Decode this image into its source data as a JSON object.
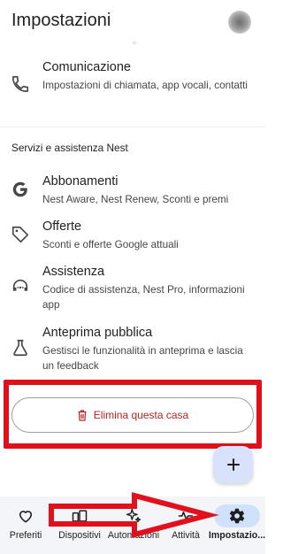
{
  "header": {
    "title": "Impostazioni"
  },
  "rows": [
    {
      "title": "Comunicazione",
      "subtitle": "Impostazioni di chiamata, app vocali, contatti",
      "icon": "phone-icon"
    },
    {
      "title": "Abbonamenti",
      "subtitle": "Nest Aware, Nest Renew, Sconti e premi",
      "icon": "google-g-icon"
    },
    {
      "title": "Offerte",
      "subtitle": "Sconti e offerte Google attuali",
      "icon": "tag-icon"
    },
    {
      "title": "Assistenza",
      "subtitle": "Codice di assistenza, Nest Pro, informazioni app",
      "icon": "support-icon"
    },
    {
      "title": "Anteprima pubblica",
      "subtitle": "Gestisci le funzionalità in anteprima e lascia un feedback",
      "icon": "flask-icon"
    }
  ],
  "section": {
    "header": "Servizi e assistenza Nest"
  },
  "delete_button": {
    "label": "Elimina questa casa",
    "color": "#b3261e"
  },
  "fab": {
    "icon": "plus-icon"
  },
  "annotation": {
    "color": "#e0101c"
  },
  "bottom_nav": [
    {
      "label": "Preferiti",
      "icon": "heart-icon"
    },
    {
      "label": "Dispositivi",
      "icon": "devices-icon"
    },
    {
      "label": "Automazioni",
      "icon": "sparkle-icon"
    },
    {
      "label": "Attività",
      "icon": "activity-icon"
    },
    {
      "label": "Impostazio...",
      "icon": "gear-icon",
      "active": true
    }
  ]
}
